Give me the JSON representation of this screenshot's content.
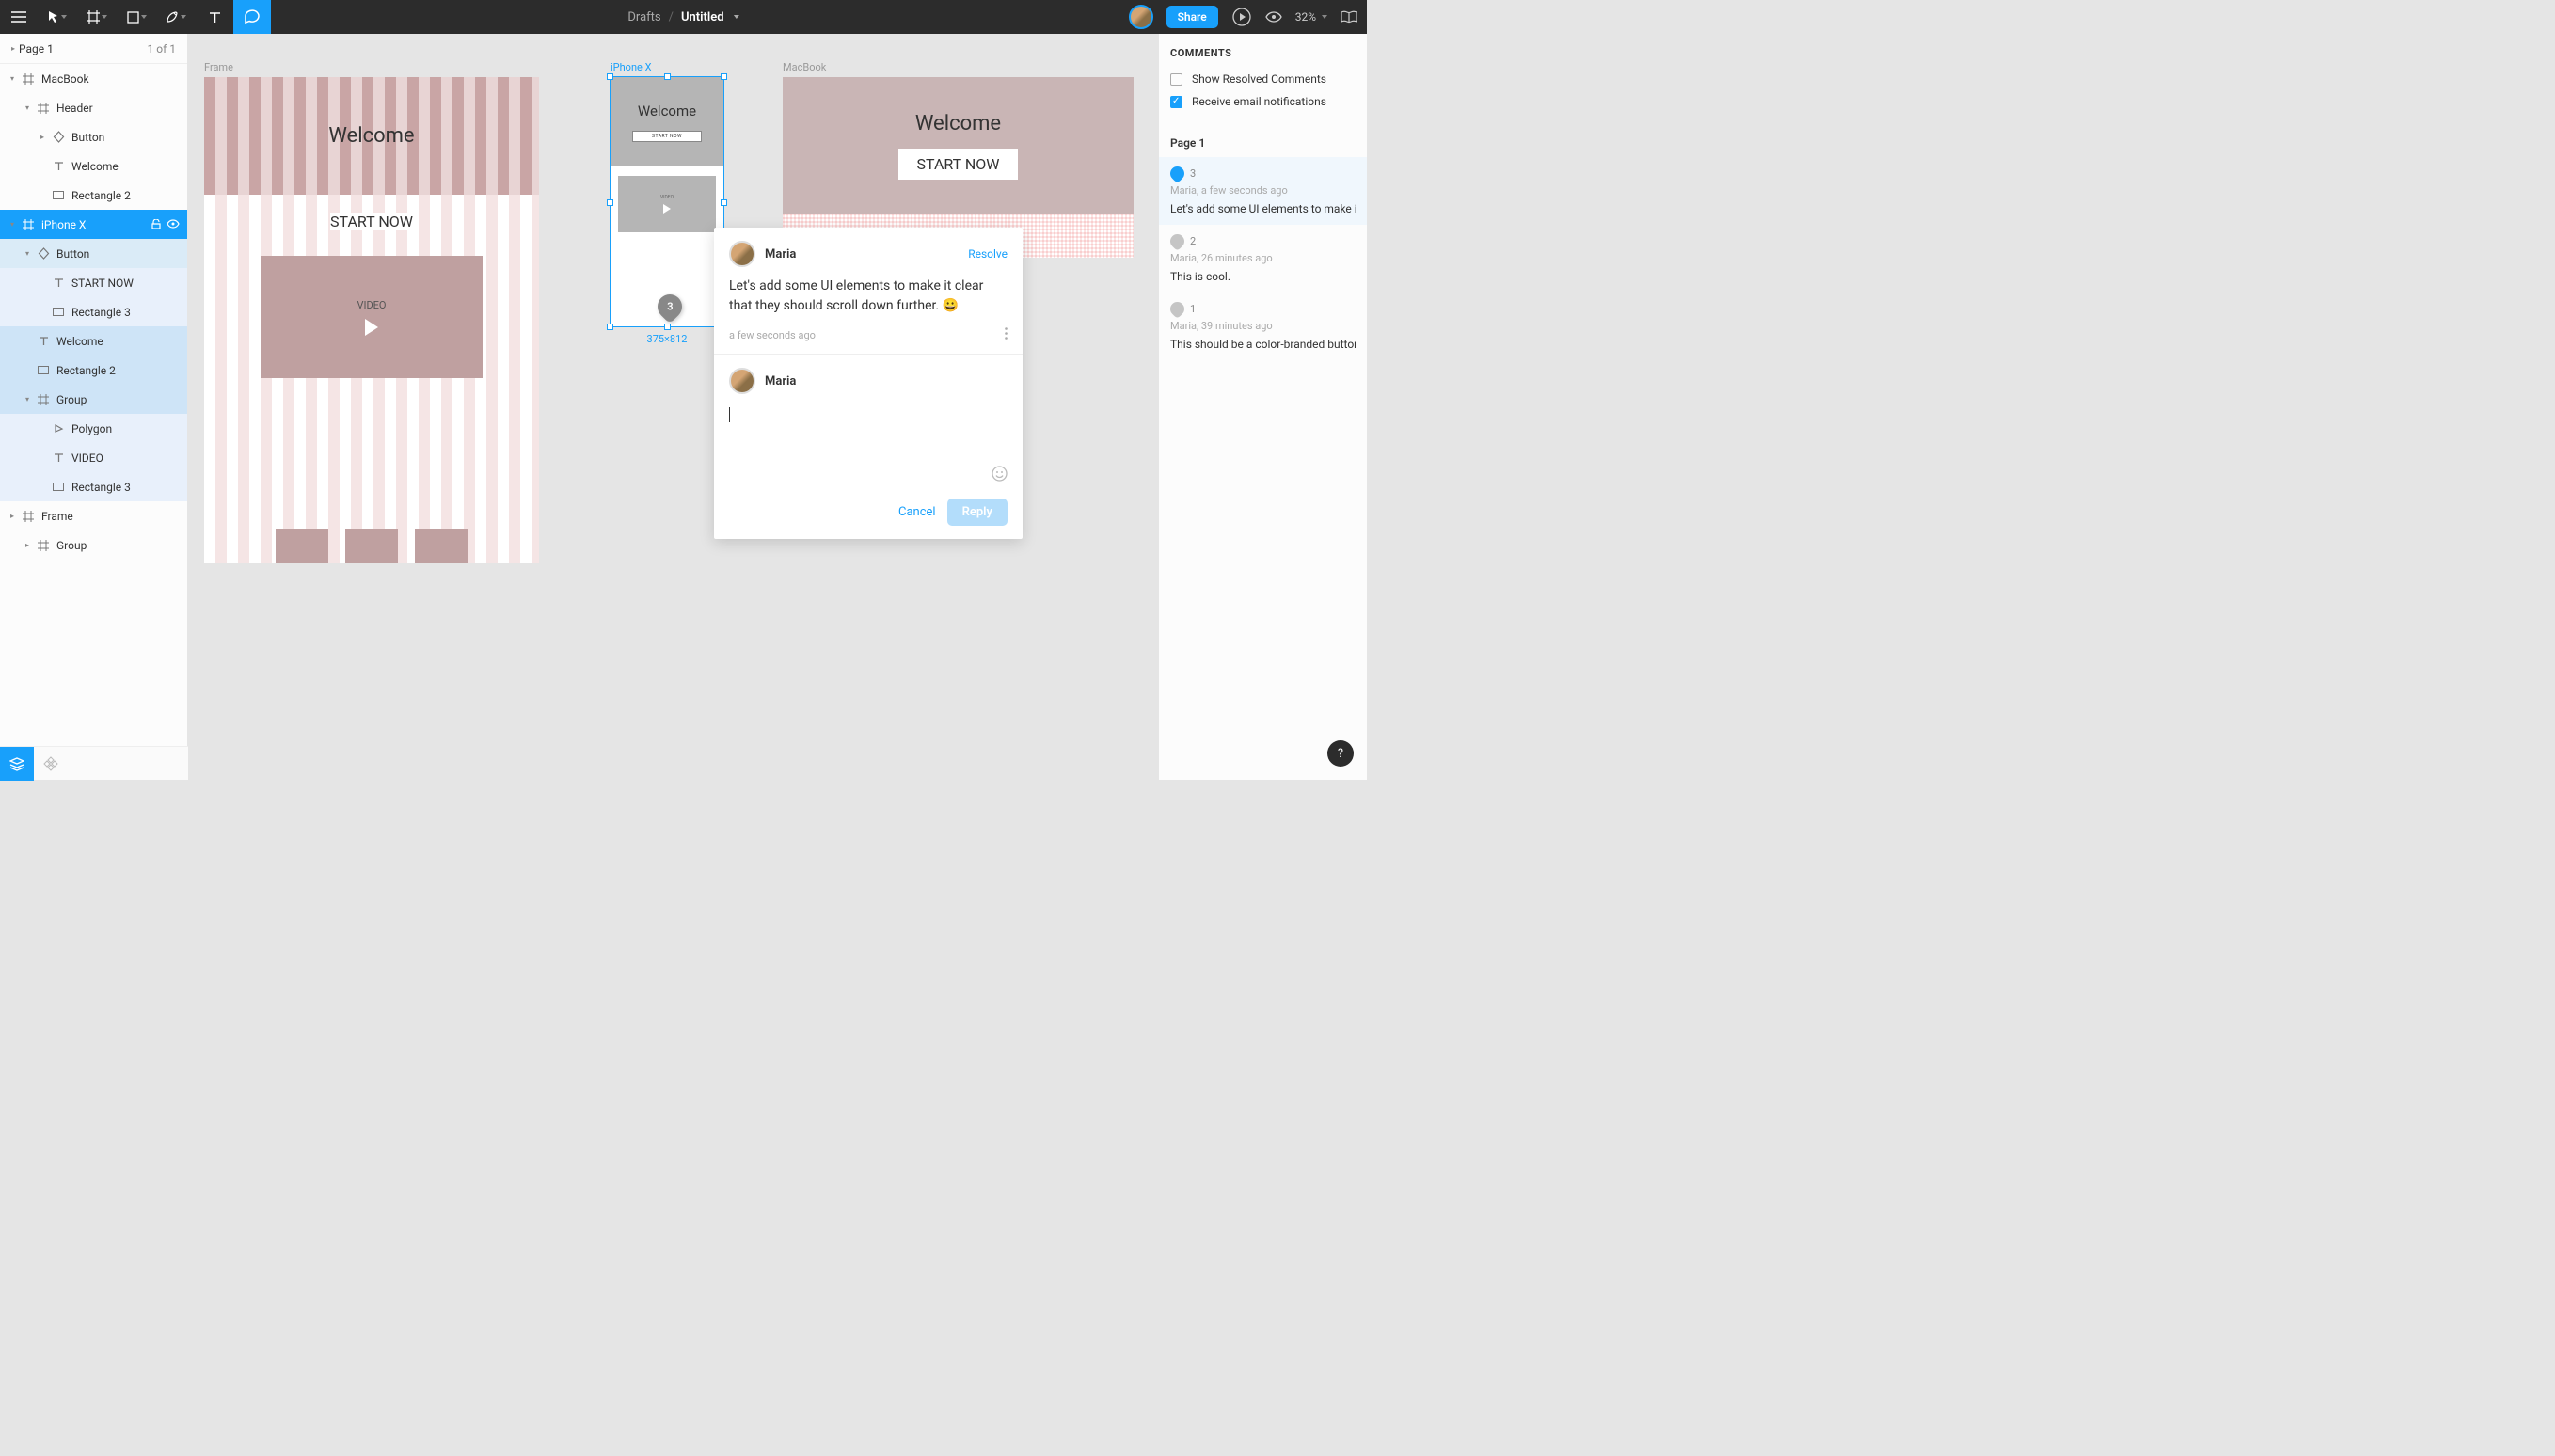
{
  "toolbar": {
    "breadcrumb_root": "Drafts",
    "breadcrumb_sep": "/",
    "title": "Untitled",
    "share_label": "Share",
    "zoom": "32%"
  },
  "pages": {
    "current": "Page 1",
    "count_text": "1 of 1"
  },
  "layers": [
    {
      "name": "MacBook",
      "indent": 0,
      "icon": "frame",
      "expand": true
    },
    {
      "name": "Header",
      "indent": 1,
      "icon": "frame",
      "expand": true
    },
    {
      "name": "Button",
      "indent": 2,
      "icon": "component",
      "expand": false,
      "chev": true
    },
    {
      "name": "Welcome",
      "indent": 2,
      "icon": "text"
    },
    {
      "name": "Rectangle 2",
      "indent": 2,
      "icon": "rect"
    },
    {
      "name": "iPhone X",
      "indent": 0,
      "icon": "frame",
      "expand": true,
      "sel": "sel",
      "lockvis": true
    },
    {
      "name": "Button",
      "indent": 1,
      "icon": "component",
      "expand": true,
      "sel": "sel-light"
    },
    {
      "name": "START NOW",
      "indent": 2,
      "icon": "text",
      "sel": "sel-lighter"
    },
    {
      "name": "Rectangle 3",
      "indent": 2,
      "icon": "rect",
      "sel": "sel-lighter"
    },
    {
      "name": "Welcome",
      "indent": 1,
      "icon": "text",
      "sel": "sel-med"
    },
    {
      "name": "Rectangle 2",
      "indent": 1,
      "icon": "rect",
      "sel": "sel-med"
    },
    {
      "name": "Group",
      "indent": 1,
      "icon": "frame",
      "expand": true,
      "sel": "sel-med"
    },
    {
      "name": "Polygon",
      "indent": 2,
      "icon": "polygon",
      "sel": "sel-lighter"
    },
    {
      "name": "VIDEO",
      "indent": 2,
      "icon": "text",
      "sel": "sel-lighter"
    },
    {
      "name": "Rectangle 3",
      "indent": 2,
      "icon": "rect",
      "sel": "sel-lighter"
    },
    {
      "name": "Frame",
      "indent": 0,
      "icon": "frame",
      "chev": true
    },
    {
      "name": "Group",
      "indent": 1,
      "icon": "frame",
      "chev": true
    }
  ],
  "canvas": {
    "frame1_label": "Frame",
    "iphone_label": "iPhone X",
    "macbook_label": "MacBook",
    "dims_text": "375×812",
    "welcome_text": "Welcome",
    "start_now_text": "START NOW",
    "video_text": "VIDEO",
    "pin_number": "3"
  },
  "comment_popup": {
    "author": "Maria",
    "resolve": "Resolve",
    "body": "Let's add some UI elements to make it clear that they should scroll down further. 😀",
    "timestamp": "a few seconds ago",
    "reply_author": "Maria",
    "cancel": "Cancel",
    "reply": "Reply"
  },
  "comments_panel": {
    "title": "COMMENTS",
    "show_resolved": "Show Resolved Comments",
    "email_notif": "Receive email notifications",
    "page_label": "Page 1",
    "items": [
      {
        "num": "3",
        "meta": "Maria, a few seconds ago",
        "text": "Let's add some UI elements to make it",
        "active": true,
        "pin": "blue"
      },
      {
        "num": "2",
        "meta": "Maria, 26 minutes ago",
        "text": "This is cool.",
        "pin": "grey"
      },
      {
        "num": "1",
        "meta": "Maria, 39 minutes ago",
        "text": "This should be a color-branded button",
        "pin": "grey"
      }
    ]
  },
  "help": "?"
}
